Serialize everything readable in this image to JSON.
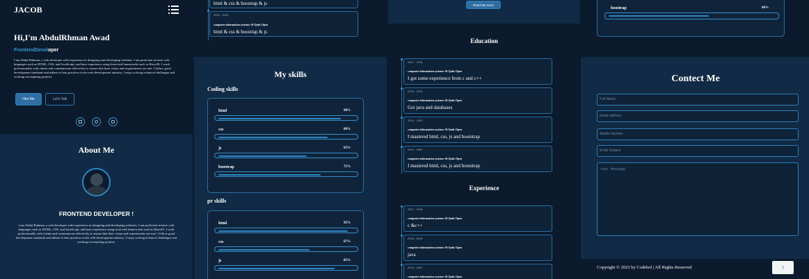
{
  "header": {
    "brand": "JACOB"
  },
  "hero": {
    "greeting": "Hi,I'm AbdulRhman Awad",
    "role_part1": "FrontendDevel",
    "role_part2": "oper",
    "bio": "I am Abdul Rahman, a web developer with experience in designing and developing websites. I am proficient in basic web languages such as HTML, CSS, and JavaScript, and have experience using front-end frameworks such as ReactJS. I work professionally with clients and communicate effectively to ensure that their vision and requirements are met. I follow good development standards and adhere to best practices in the web development industry. I enjoy solving technical challenges and working on inspiring projects.",
    "hire_label": "Hire Me",
    "talk_label": "Let's Talk",
    "social_icons": [
      "linkedin-icon",
      "github-icon",
      "instagram-icon"
    ]
  },
  "about": {
    "title": "About Me",
    "subtitle": "FRONTEND DEVELOPER !",
    "text": "I am Abdul Rahman, a web developer with experience in designing and developing websites. I am proficient in basic web languages such as HTML, CSS, and JavaScript, and have experience using front-end frameworks such as ReactJS. I work professionally with clients and communicate effectively to ensure that their vision and requirements are met. I follow good development standards and adhere to best practices in the web development industry. I enjoy solving technical challenges and working on inspiring projects."
  },
  "timeline_top": [
    {
      "text": "html & css & boostrap & js"
    },
    {
      "date": "2019 - 2020",
      "org": "computer information systems-Al-Quds Open",
      "text": "html & css & boostrap & js"
    }
  ],
  "skills": {
    "title": "My skills",
    "coding_title": "Coding skills",
    "coding": [
      {
        "name": "html",
        "pct": "90%",
        "value": 90
      },
      {
        "name": "css",
        "pct": "80%",
        "value": 80
      },
      {
        "name": "js",
        "pct": "65%",
        "value": 65
      },
      {
        "name": "boostrap",
        "pct": "75%",
        "value": 75
      }
    ],
    "pr_title": "pr skills",
    "pr": [
      {
        "name": "html",
        "pct": "95%",
        "value": 95
      },
      {
        "name": "css",
        "pct": "67%",
        "value": 67
      },
      {
        "name": "js",
        "pct": "85%",
        "value": 85
      }
    ]
  },
  "read_more_label": "Read Me more",
  "education": {
    "title": "Education",
    "items": [
      {
        "date": "2017 - 2018",
        "org": "computer information systems-Al-Quds Open",
        "text": "I got some experience from c and c++"
      },
      {
        "date": "2018 - 2019",
        "org": "computer information systems-Al-Quds Open",
        "text": "Got java and databases"
      },
      {
        "date": "2019 - 2020",
        "org": "computer information systems-Al-Quds Open",
        "text": "I mastered html, css, js and bootstrap"
      },
      {
        "date": "2019 - 2020",
        "org": "computer information systems-Al-Quds Open",
        "text": "I mastered html, css, js and bootstrap"
      }
    ]
  },
  "experience": {
    "title": "Experience",
    "items": [
      {
        "date": "2017 - 2018",
        "org": "computer information systems-Al-Quds Open",
        "text": "c &c++"
      },
      {
        "date": "2018 - 2019",
        "org": "computer information systems-Al-Quds Open",
        "text": "java"
      },
      {
        "date": "2019 - 2020",
        "org": "computer information systems-Al-Quds Open",
        "text": ""
      }
    ]
  },
  "panel4_skill": {
    "name": "boostrap",
    "pct": "60%",
    "value": 60
  },
  "contact": {
    "title": "Contect Me",
    "full_name": "Full Name",
    "email": "Email address",
    "mobile": "Mobile Number",
    "subject": "Email Subject",
    "message": "Your Message"
  },
  "footer": {
    "copyright": "Copyright © 2023 by Codehol | All Rights Reserved",
    "top_label": "↑"
  },
  "colors": {
    "bg_dark": "#0b1a2c",
    "bg_light": "#112a45",
    "accent": "#2f88c8"
  }
}
